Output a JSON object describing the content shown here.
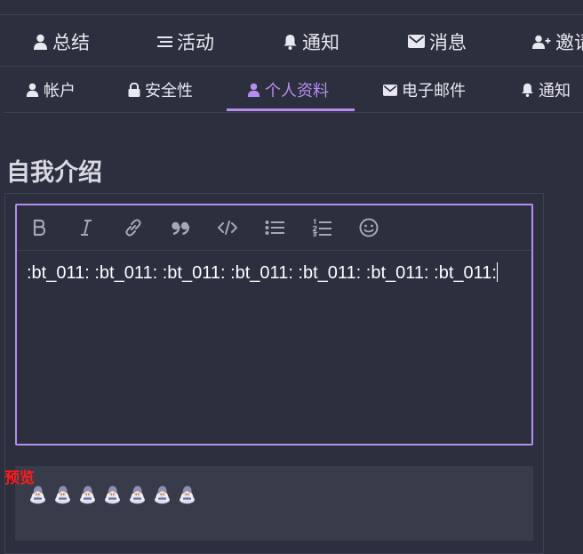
{
  "nav_primary": {
    "items": [
      {
        "label": "总结",
        "icon": "user-icon"
      },
      {
        "label": "活动",
        "icon": "list-icon"
      },
      {
        "label": "通知",
        "icon": "bell-icon"
      },
      {
        "label": "消息",
        "icon": "envelope-icon"
      },
      {
        "label": "邀请",
        "icon": "user-plus-icon"
      }
    ]
  },
  "nav_secondary": {
    "items": [
      {
        "label": "帐户",
        "icon": "user-icon"
      },
      {
        "label": "安全性",
        "icon": "lock-icon"
      },
      {
        "label": "个人资料",
        "icon": "user-icon",
        "active": true
      },
      {
        "label": "电子邮件",
        "icon": "envelope-icon"
      },
      {
        "label": "通知",
        "icon": "bell-icon"
      }
    ]
  },
  "section": {
    "title": "自我介绍"
  },
  "editor": {
    "toolbar": [
      "bold-icon",
      "italic-icon",
      "link-icon",
      "quote-icon",
      "code-icon",
      "bullet-list-icon",
      "numbered-list-icon",
      "emoji-icon"
    ],
    "content": ":bt_011: :bt_011: :bt_011: :bt_011: :bt_011: :bt_011: :bt_011:"
  },
  "preview": {
    "label": "预览",
    "emoji_count": 7
  },
  "colors": {
    "background": "#2c2f3d",
    "accent": "#b98cf0",
    "preview_label": "#ff1a1a",
    "preview_bg": "#383b49"
  }
}
